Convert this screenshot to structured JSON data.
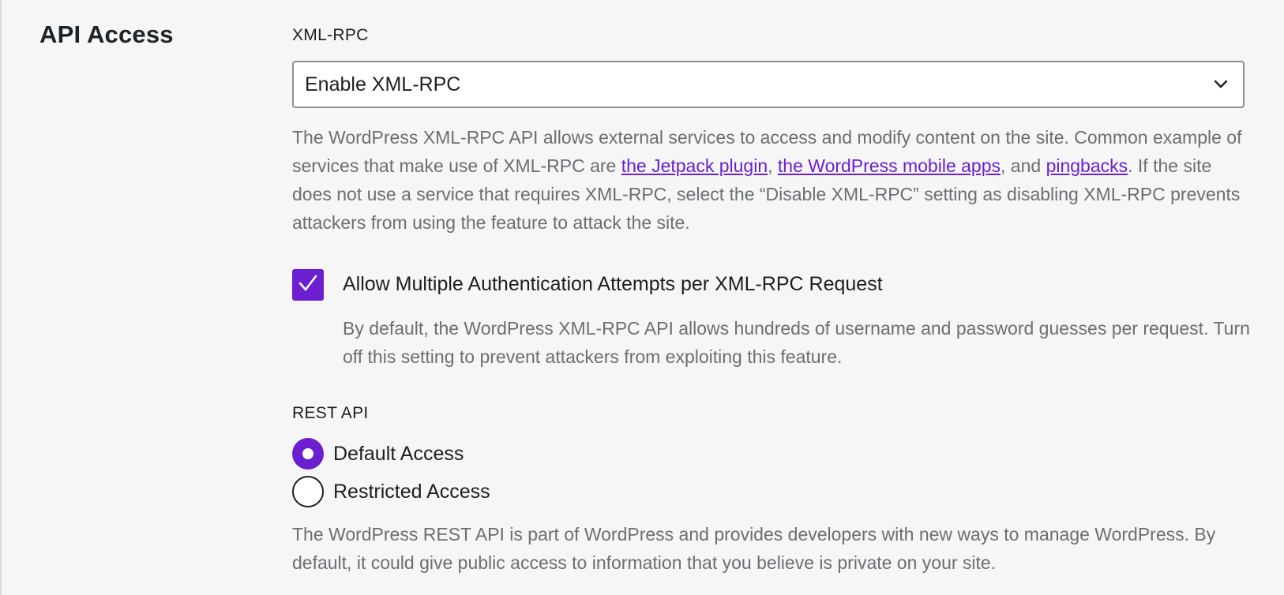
{
  "section": {
    "title": "API Access"
  },
  "xmlrpc": {
    "label": "XML-RPC",
    "select_value": "Enable XML-RPC",
    "description": {
      "part1": "The WordPress XML-RPC API allows external services to access and modify content on the site. Common example of services that make use of XML-RPC are ",
      "link1": "the Jetpack plugin",
      "sep1": ", ",
      "link2": "the WordPress mobile apps",
      "sep2": ", and ",
      "link3": "pingbacks",
      "part2": ". If the site does not use a service that requires XML-RPC, select the “Disable XML-RPC” setting as disabling XML-RPC prevents attackers from using the feature to attack the site."
    },
    "checkbox": {
      "label": "Allow Multiple Authentication Attempts per XML-RPC Request",
      "checked": true,
      "description": "By default, the WordPress XML-RPC API allows hundreds of username and password guesses per request. Turn off this setting to prevent attackers from exploiting this feature."
    }
  },
  "rest_api": {
    "label": "REST API",
    "options": [
      {
        "label": "Default Access",
        "selected": true
      },
      {
        "label": "Restricted Access",
        "selected": false
      }
    ],
    "description": "The WordPress REST API is part of WordPress and provides developers with new ways to manage WordPress. By default, it could give public access to information that you believe is private on your site."
  },
  "colors": {
    "accent": "#6b1fd0",
    "background": "#f5f6f5",
    "muted_text": "#6b6e73"
  },
  "icons": {
    "select_chevron": "chevron-down-icon",
    "checkbox_check": "checkmark-icon"
  }
}
